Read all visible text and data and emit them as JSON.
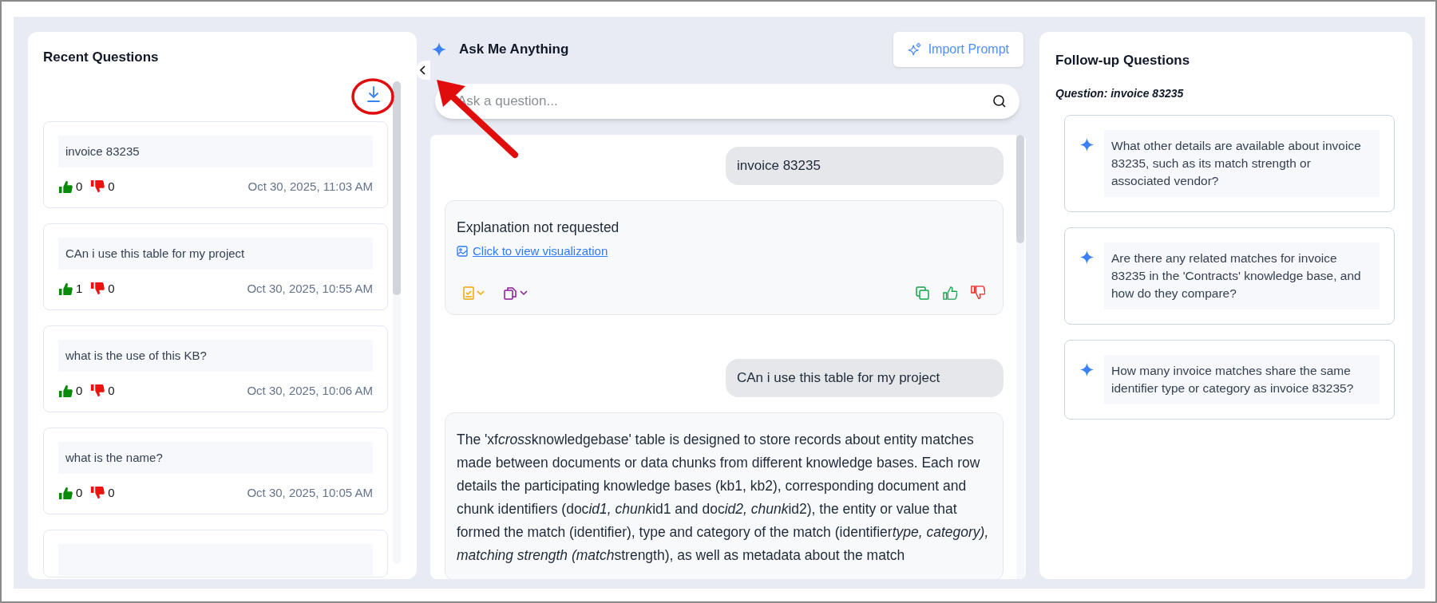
{
  "recent_questions": {
    "title": "Recent Questions",
    "items": [
      {
        "question": "invoice 83235",
        "likes": "0",
        "dislikes": "0",
        "timestamp": "Oct 30, 2025, 11:03 AM"
      },
      {
        "question": "CAn i use this table for my project",
        "likes": "1",
        "dislikes": "0",
        "timestamp": "Oct 30, 2025, 10:55 AM"
      },
      {
        "question": "what is the use of this KB?",
        "likes": "0",
        "dislikes": "0",
        "timestamp": "Oct 30, 2025, 10:06 AM"
      },
      {
        "question": "what is the name?",
        "likes": "0",
        "dislikes": "0",
        "timestamp": "Oct 30, 2025, 10:05 AM"
      }
    ]
  },
  "chat": {
    "title": "Ask Me Anything",
    "import_button": "Import Prompt",
    "search": {
      "placeholder": "Ask a question..."
    },
    "messages": [
      {
        "kind": "user",
        "text": "invoice 83235"
      },
      {
        "kind": "answer",
        "text": "Explanation not requested",
        "link": "Click to view visualization",
        "toolbar": true
      },
      {
        "kind": "user",
        "text": "CAn i use this table for my project"
      },
      {
        "kind": "answer",
        "segments": [
          {
            "text": "The 'xf",
            "italic": false
          },
          {
            "text": "cross",
            "italic": true
          },
          {
            "text": "knowledgebase' table is designed to store records about entity matches made between documents or data chunks from different knowledge bases. Each row details the participating knowledge bases (kb1, kb2), corresponding document and chunk identifiers (doc",
            "italic": false
          },
          {
            "text": "id1, chunk",
            "italic": true
          },
          {
            "text": "id1 and doc",
            "italic": false
          },
          {
            "text": "id2, chunk",
            "italic": true
          },
          {
            "text": "id2), the entity or value that formed the match (identifier), type and category of the match (identifier",
            "italic": false
          },
          {
            "text": "type, category), matching strength (match",
            "italic": true
          },
          {
            "text": "strength), as well as metadata about the match",
            "italic": false
          }
        ]
      }
    ]
  },
  "follow_up": {
    "title": "Follow-up Questions",
    "question_label": "Question: invoice 83235",
    "suggestions": [
      "What other details are available about invoice 83235, such as its match strength or associated vendor?",
      "Are there any related matches for invoice 83235 in the 'Contracts' knowledge base, and how do they compare?",
      "How many invoice matches share the same identifier type or category as invoice 83235?"
    ]
  }
}
